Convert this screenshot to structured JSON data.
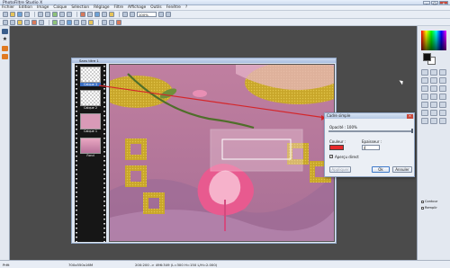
{
  "app": {
    "title": "PhotoFiltre Studio X"
  },
  "menu": [
    "Fichier",
    "Edition",
    "Image",
    "Calque",
    "Sélection",
    "Réglage",
    "Filtre",
    "Affichage",
    "Outils",
    "Fenêtre",
    "?"
  ],
  "toolbar": {
    "zoom": "100%"
  },
  "document": {
    "title": "Sans titre 1",
    "layers": [
      {
        "label": "Calque 3",
        "selected": true
      },
      {
        "label": "Calque 2",
        "selected": false
      },
      {
        "label": "Calque 1",
        "selected": false
      },
      {
        "label": "Fond",
        "selected": false
      }
    ]
  },
  "dialog": {
    "title": "Cadre simple",
    "opacity_label": "Opacité : 100%",
    "color_label": "Couleur :",
    "thickness_label": "Epaisseur :",
    "thickness_value": "4",
    "preview_label": "Aperçu direct",
    "apply_button": "Appliquer",
    "ok_button": "Ok",
    "cancel_button": "Annuler",
    "color_value": "#e8292b"
  },
  "palette": {
    "contour_label": "Contour",
    "fill_label": "Remplir"
  },
  "status": {
    "state": "Prêt",
    "size": "700x550x16M",
    "coords": "200:200 -> 496:349 (L=300 H=150 L/H=2.000)"
  },
  "colors": {
    "accent_red": "#d4262a",
    "canvas_pink": "#c98fa8",
    "gold": "#c8a62a"
  }
}
